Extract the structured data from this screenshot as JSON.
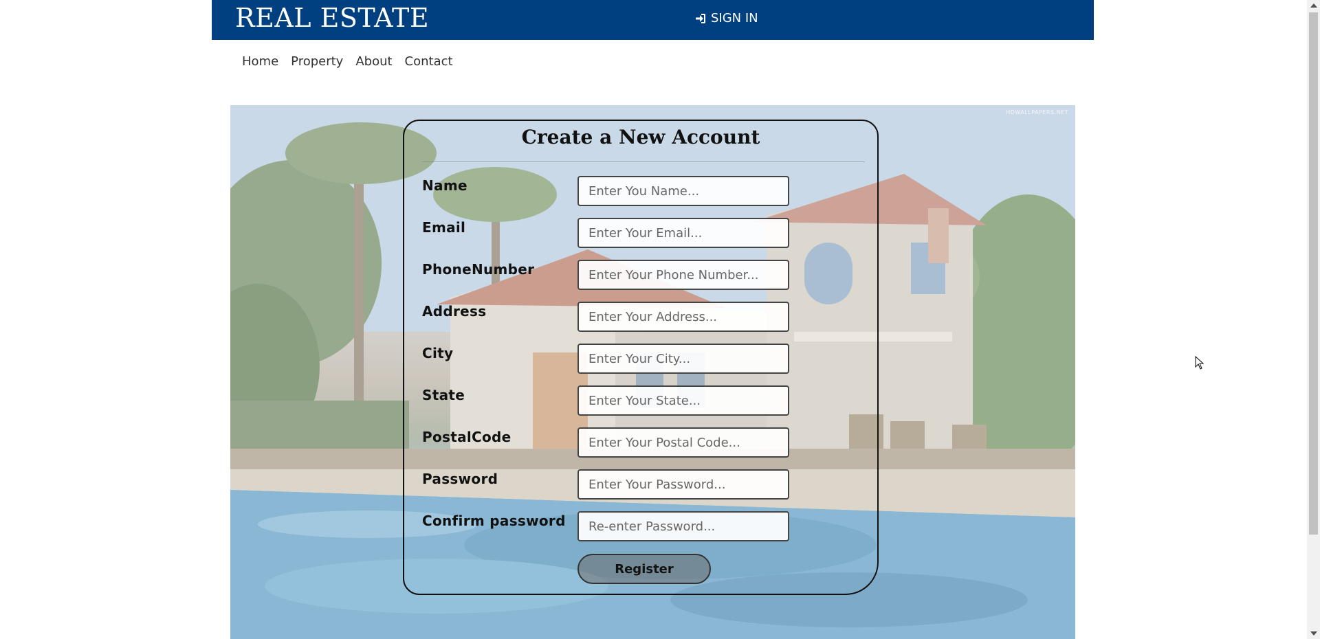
{
  "header": {
    "brand": "REAL ESTATE",
    "signin_label": "SIGN IN",
    "signin_icon": "sign-in-icon",
    "background_color": "#004080"
  },
  "nav": {
    "items": [
      {
        "label": "Home"
      },
      {
        "label": "Property"
      },
      {
        "label": "About"
      },
      {
        "label": "Contact"
      }
    ]
  },
  "hero": {
    "watermark": "HDWALLPAPERS.NET"
  },
  "form": {
    "title": "Create a New Account",
    "fields": [
      {
        "label": "Name",
        "placeholder": "Enter You Name..."
      },
      {
        "label": "Email",
        "placeholder": "Enter Your Email..."
      },
      {
        "label": "PhoneNumber",
        "placeholder": "Enter Your Phone Number..."
      },
      {
        "label": "Address",
        "placeholder": "Enter Your Address..."
      },
      {
        "label": "City",
        "placeholder": "Enter Your City..."
      },
      {
        "label": "State",
        "placeholder": "Enter Your State..."
      },
      {
        "label": "PostalCode",
        "placeholder": "Enter Your Postal Code..."
      },
      {
        "label": "Password",
        "placeholder": "Enter Your Password..."
      },
      {
        "label": "Confirm password",
        "placeholder": "Re-enter Password..."
      }
    ],
    "submit_label": "Register"
  }
}
